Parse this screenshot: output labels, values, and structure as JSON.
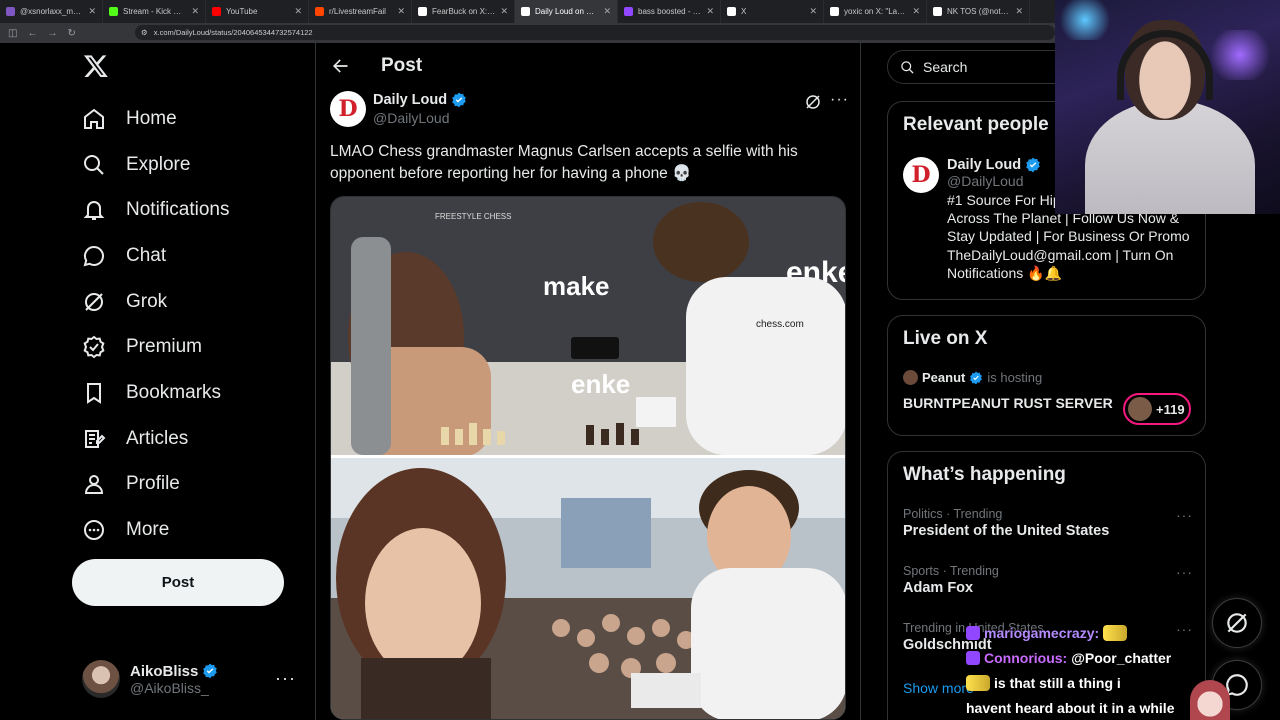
{
  "browser": {
    "tabs": [
      {
        "label": "@xsnorlaxx_mentioned",
        "color": "#7e57c2",
        "active": false
      },
      {
        "label": "Stream - Kick Dashboard",
        "color": "#53fc18",
        "active": false
      },
      {
        "label": "YouTube",
        "color": "#ff0000",
        "active": false
      },
      {
        "label": "r/LivestreamFail",
        "color": "#ff4500",
        "active": false
      },
      {
        "label": "FearBuck on X: \"Jake Paul s",
        "color": "#ffffff",
        "active": false
      },
      {
        "label": "Daily Loud on X: \"LMAO",
        "color": "#ffffff",
        "active": true
      },
      {
        "label": "bass boosted - Twitch",
        "color": "#9146ff",
        "active": false
      },
      {
        "label": "X",
        "color": "#ffffff",
        "active": false
      },
      {
        "label": "yoxic on X: \"Lacy had a wh",
        "color": "#ffffff",
        "active": false
      },
      {
        "label": "NK TOS (@notkyrell.tos) • I",
        "color": "#ffffff",
        "active": false
      }
    ],
    "url": "x.com/DailyLoud/status/2040645344732574122"
  },
  "sidebar": {
    "nav": [
      {
        "label": "Home",
        "icon": "home-icon"
      },
      {
        "label": "Explore",
        "icon": "search-icon"
      },
      {
        "label": "Notifications",
        "icon": "bell-icon"
      },
      {
        "label": "Chat",
        "icon": "chat-icon"
      },
      {
        "label": "Grok",
        "icon": "grok-icon"
      },
      {
        "label": "Premium",
        "icon": "premium-icon"
      },
      {
        "label": "Bookmarks",
        "icon": "bookmark-icon"
      },
      {
        "label": "Articles",
        "icon": "articles-icon"
      },
      {
        "label": "Profile",
        "icon": "profile-icon"
      },
      {
        "label": "More",
        "icon": "more-circle-icon"
      }
    ],
    "post_label": "Post",
    "account": {
      "name": "AikoBliss",
      "handle": "@AikoBliss_"
    }
  },
  "main": {
    "header_title": "Post",
    "author": {
      "name": "Daily Loud",
      "handle": "@DailyLoud",
      "avatar_letter": "D"
    },
    "text": "LMAO Chess grandmaster Magnus Carlsen accepts a selfie with his opponent before reporting her for having a phone 💀",
    "media_text": {
      "brand1": "make",
      "brand2": "enke",
      "brand3": "enke",
      "freestyle": "FREESTYLE CHESS",
      "shirt": "chess.com"
    }
  },
  "right": {
    "search_placeholder": "Search",
    "relevant": {
      "title": "Relevant people",
      "name": "Daily Loud",
      "handle": "@DailyLoud",
      "bio": "#1 Source For Hip Hop & Culture Across The Planet | Follow Us Now & Stay Updated | For Business Or Promo TheDailyLoud@gmail.com | Turn On Notifications 🔥🔔"
    },
    "live": {
      "title": "Live on X",
      "host_name": "Peanut",
      "host_suffix": "is hosting",
      "space_title": "BURNTPEANUT RUST SERVER",
      "listener_count": "+119"
    },
    "happening": {
      "title": "What’s happening",
      "trends": [
        {
          "meta": "Politics · Trending",
          "name": "President of the United States"
        },
        {
          "meta": "Sports · Trending",
          "name": "Adam Fox"
        },
        {
          "meta": "Trending in United States",
          "name": "Goldschmidt"
        }
      ],
      "show_more": "Show more"
    }
  },
  "chat": [
    {
      "user": "mariogamecrazy:",
      "user_color": "#b48cff",
      "msg": ""
    },
    {
      "user": "Connorious:",
      "user_color": "#c96bff",
      "msg": "@Poor_chatter"
    },
    {
      "user": "",
      "user_color": "#ffffff",
      "msg": "is that still a thing i"
    },
    {
      "user": "",
      "user_color": "#ffffff",
      "msg": "havent heard about it in a while"
    }
  ],
  "colors": {
    "accent": "#1d9bf0",
    "verified": "#1d9bf0",
    "live_pink": "#f91880"
  }
}
